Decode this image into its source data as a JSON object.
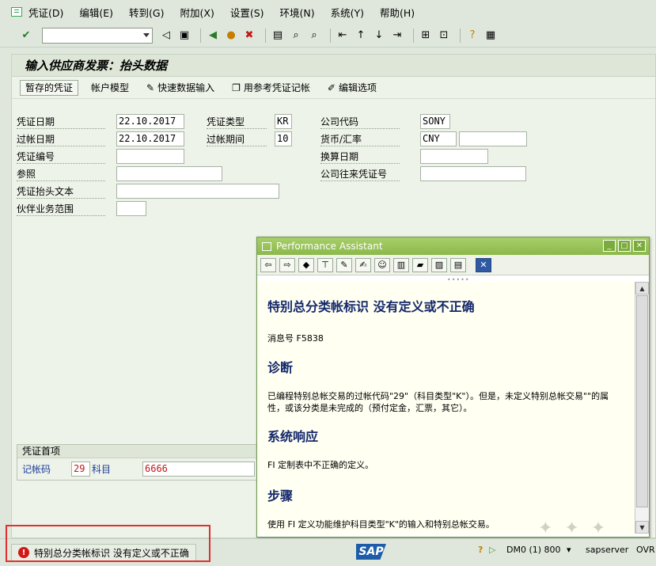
{
  "menubar": {
    "items": [
      "凭证(D)",
      "编辑(E)",
      "转到(G)",
      "附加(X)",
      "设置(S)",
      "环境(N)",
      "系统(Y)",
      "帮助(H)"
    ]
  },
  "screen": {
    "title": "输入供应商发票：抬头数据"
  },
  "app_toolbar": {
    "parked": "暂存的凭证",
    "account_model": "帐户模型",
    "fast_entry": "快速数据输入",
    "post_with_ref": "用参考凭证记帐",
    "edit_options": "编辑选项"
  },
  "header": {
    "doc_date_label": "凭证日期",
    "doc_date": "22.10.2017",
    "doc_type_label": "凭证类型",
    "doc_type": "KR",
    "company_code_label": "公司代码",
    "company_code": "SONY",
    "posting_date_label": "过帐日期",
    "posting_date": "22.10.2017",
    "period_label": "过帐期间",
    "period": "10",
    "currency_label": "货币/汇率",
    "currency": "CNY",
    "exchange_rate": "",
    "doc_number_label": "凭证编号",
    "doc_number": "",
    "translation_date_label": "换算日期",
    "translation_date": "",
    "reference_label": "参照",
    "reference": "",
    "cross_cc_label": "公司往来凭证号",
    "cross_cc": "",
    "header_text_label": "凭证抬头文本",
    "header_text": "",
    "trading_partner_label": "伙伴业务范围",
    "trading_partner": ""
  },
  "first_line": {
    "section_title": "凭证首项",
    "posting_key_label": "记帐码",
    "posting_key": "29",
    "account_label": "科目",
    "account": "6666"
  },
  "popup": {
    "title": "Performance Assistant",
    "heading": "特别总分类帐标识 没有定义或不正确",
    "message_no": "消息号 F5838",
    "diagnosis_title": "诊断",
    "diagnosis_text": "已编程特别总帐交易的过帐代码\"29\"（科目类型\"K\"）。但是，未定义特别总帐交易\"\"的属性，或该分类是未完成的（预付定金，汇票，其它）。",
    "system_response_title": "系统响应",
    "system_response_text": "FI 定制表中不正确的定义。",
    "procedure_title": "步骤",
    "procedure_text": "使用 FI 定义功能维护科目类型\"K\"的输入和特别总帐交易。"
  },
  "status": {
    "message": "特别总分类帐标识 没有定义或不正确",
    "sap_logo": "SAP",
    "system": "DM0 (1) 800",
    "server": "sapserver",
    "mode": "OVR"
  },
  "colors": {
    "error": "#d01818",
    "highlight_outline": "#e03030",
    "popup_title_bar": "#8cb84c",
    "heading_text": "#14286a"
  }
}
